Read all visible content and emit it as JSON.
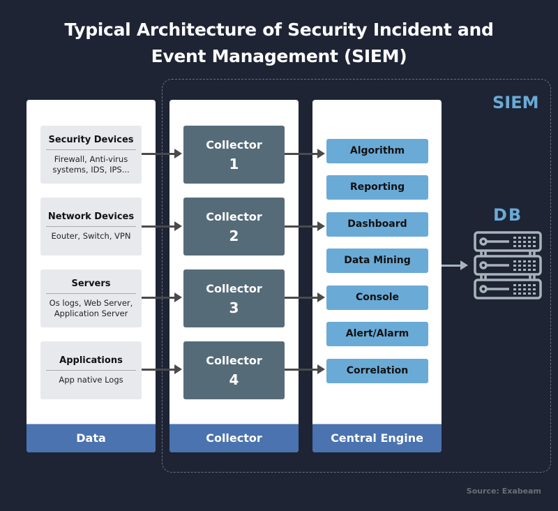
{
  "title": {
    "line1": "Typical Architecture of Security Incident and",
    "line2": "Event Management (SIEM)"
  },
  "siem_label": "SIEM",
  "columns": {
    "data": {
      "footer": "Data",
      "sources": [
        {
          "title": "Security Devices",
          "desc_line1": "Firewall, Anti-virus",
          "desc_line2": "systems, IDS, IPS..."
        },
        {
          "title": "Network Devices",
          "desc_line1": "Eouter, Switch, VPN",
          "desc_line2": ""
        },
        {
          "title": "Servers",
          "desc_line1": "Os logs, Web Server,",
          "desc_line2": "Application Server"
        },
        {
          "title": "Applications",
          "desc_line1": "App native Logs",
          "desc_line2": ""
        }
      ]
    },
    "collector": {
      "footer": "Collector",
      "collectors": [
        {
          "name": "Collector",
          "number": "1"
        },
        {
          "name": "Collector",
          "number": "2"
        },
        {
          "name": "Collector",
          "number": "3"
        },
        {
          "name": "Collector",
          "number": "4"
        }
      ]
    },
    "engine": {
      "footer": "Central Engine",
      "modules": [
        "Algorithm",
        "Reporting",
        "Dashboard",
        "Data Mining",
        "Console",
        "Alert/Alarm",
        "Correlation"
      ]
    }
  },
  "db": {
    "label": "DB",
    "icon": "server-stack-icon"
  },
  "source_note": "Source: Exabeam",
  "colors": {
    "background": "#1e2434",
    "accent_blue": "#6aaad6",
    "footer_blue": "#4a73b0",
    "collector_gray": "#566b78",
    "source_box": "#e8e9ed"
  }
}
